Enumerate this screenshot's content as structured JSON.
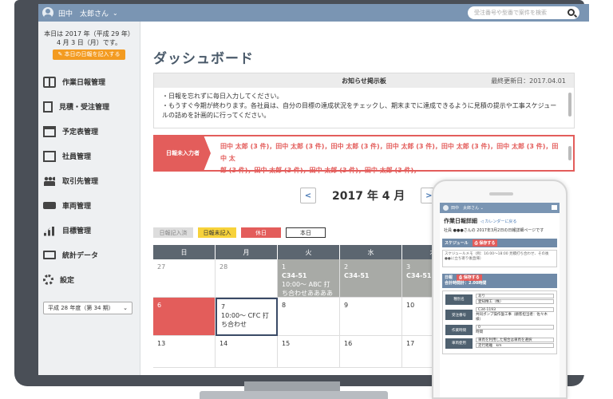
{
  "header": {
    "username": "田中　太郎さん",
    "dropdown_icon": "chevron-down-icon",
    "search_placeholder": "受注番号や型番で案件を検索"
  },
  "sidebar": {
    "today_line1": "本日は 2017 年（平成 29 年）",
    "today_line2": "4 月 3 日（月）です。",
    "report_button": "本日の日報を記入する",
    "items": [
      {
        "label": "作業日報管理",
        "icon": "book-icon"
      },
      {
        "label": "見積・受注管理",
        "icon": "document-icon"
      },
      {
        "label": "予定表管理",
        "icon": "calendar-icon"
      },
      {
        "label": "社員管理",
        "icon": "building-icon"
      },
      {
        "label": "取引先管理",
        "icon": "people-icon"
      },
      {
        "label": "車両管理",
        "icon": "truck-icon"
      },
      {
        "label": "目標管理",
        "icon": "bar-chart-icon"
      },
      {
        "label": "統計データ",
        "icon": "monitor-icon"
      },
      {
        "label": "設定",
        "icon": "gear-icon"
      }
    ],
    "period_select": "平成 28 年度（第 34 期）"
  },
  "main": {
    "title": "ダッシュボード",
    "notice": {
      "heading": "お知らせ掲示板",
      "updated": "最終更新日：2017.04.01",
      "line1": "・日報を忘れずに毎日入力してください。",
      "line2": "・もうすぐ今期が終わります。各社員は、自分の目標の達成状況をチェックし、期末までに達成できるように見積の提示や工事スケジュールの詰めを計画的に行ってください。"
    },
    "alert": {
      "label": "日報未入力者",
      "line1": "田中 太郎 (3 件)，田中 太郎 (3 件)，田中 太郎 (3 件)，田中 太郎 (3 件)，田中 太郎 (3 件)，田中 太郎 (3 件)，田中 太",
      "line2": "郎 (3 件)，田中 太郎 (3 件)，田中 太郎 (3 件)，田中 太郎 (3 件)，"
    },
    "month_title": "2017 年 4 月",
    "prev": "<",
    "next": ">",
    "legend": {
      "done": "日報記入済",
      "notyet": "日報未記入",
      "holiday": "休日",
      "today": "本日"
    },
    "calendar": {
      "headers": [
        "日",
        "月",
        "火",
        "水",
        "木"
      ],
      "row1": [
        "27",
        "28",
        "1",
        "2",
        "3"
      ],
      "row1_events": {
        "tue_code": "C34-51",
        "tue_text": "10:00〜 ABC 打ち合わせあああああ〜",
        "wed_code": "C34-51",
        "thu_code": "C34-51"
      },
      "row2": [
        "6",
        "7",
        "8",
        "9",
        "10"
      ],
      "row2_event": "10:00〜 CFC 打ち合わせ",
      "row3": [
        "13",
        "14",
        "15",
        "16",
        "17"
      ]
    }
  },
  "phone": {
    "username": "田中　太郎さん ⌄",
    "title": "作業日報詳細",
    "back_link": "◁ カレンダーに戻る",
    "subtitle": "社員 ●●●さんの 2017年3月2日の日報詳細ページです",
    "schedule_label": "スケジュール",
    "save": "⎙ 保存する",
    "memo": "スケジュールメモ（例：16:00〜18:00 見積打ち合わせ、その後●●に立ち寄り後直帰）",
    "daily_label": "日報",
    "total": "合計時間計：2.00時間",
    "form": [
      {
        "label": "種別名",
        "v1": "あり",
        "v2": "愛知精工（株）"
      },
      {
        "label": "受注番号",
        "v1": "C34-1193",
        "v2": "共同ポンプ操作盤工事（顧客担当者：佐々木 様）"
      },
      {
        "label": "作業時間",
        "v1": "0",
        "v2": "時間"
      },
      {
        "label": "車両使用",
        "v1": "車両を利用した場合は車両を選択",
        "v2": "走行距離　km"
      }
    ]
  }
}
